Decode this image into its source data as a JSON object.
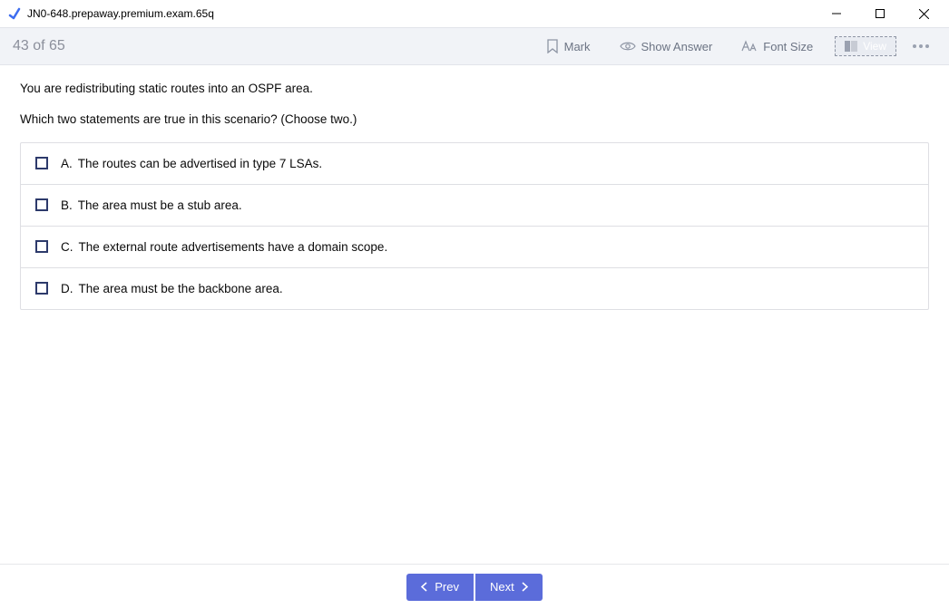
{
  "window": {
    "title": "JN0-648.prepaway.premium.exam.65q"
  },
  "toolbar": {
    "counter": "43 of 65",
    "mark_label": "Mark",
    "show_answer_label": "Show Answer",
    "font_size_label": "Font Size",
    "view_label": "View"
  },
  "question": {
    "line1": "You are redistributing static routes into an OSPF area.",
    "line2": "Which two statements are true in this scenario? (Choose two.)"
  },
  "answers": [
    {
      "letter": "A.",
      "text": "The routes can be advertised in type 7 LSAs."
    },
    {
      "letter": "B.",
      "text": "The area must be a stub area."
    },
    {
      "letter": "C.",
      "text": "The external route advertisements have a domain scope."
    },
    {
      "letter": "D.",
      "text": "The area must be the backbone area."
    }
  ],
  "footer": {
    "prev_label": "Prev",
    "next_label": "Next"
  }
}
